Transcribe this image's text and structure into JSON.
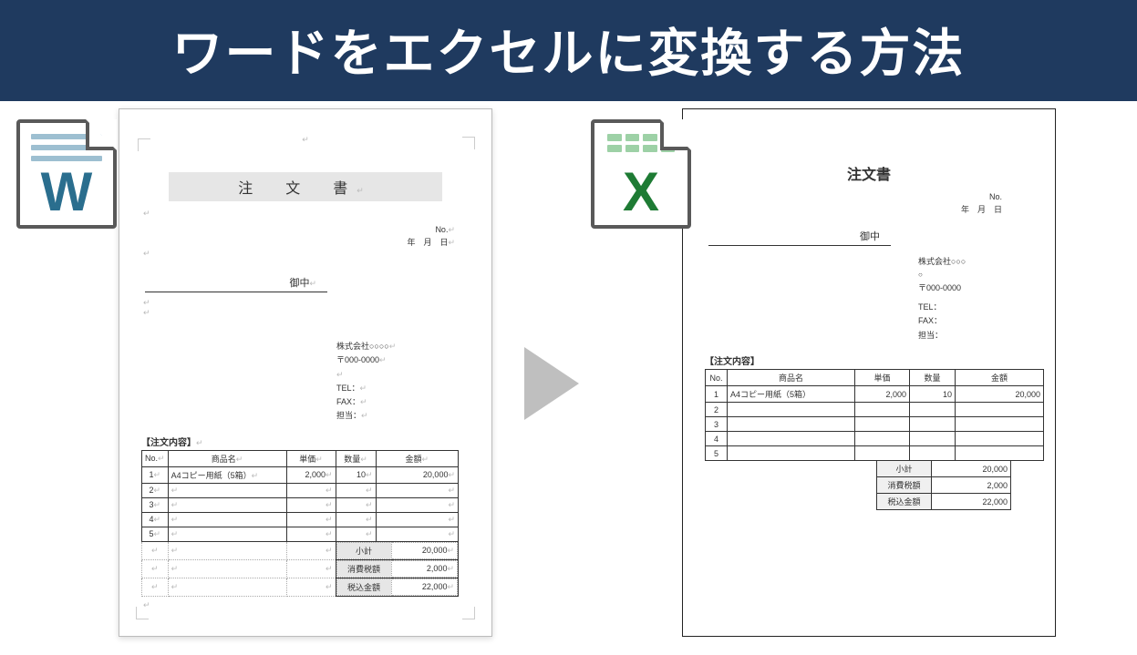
{
  "banner": "ワードをエクセルに変換する方法",
  "icons": {
    "word": "W",
    "excel": "X"
  },
  "word_doc": {
    "title": "注　文　書",
    "no_label": "No.",
    "date_suffix": "年　月　日",
    "onchuu": "御中",
    "company": "株式会社○○○○",
    "postal": "〒000-0000",
    "tel": "TEL：",
    "fax": "FAX：",
    "tantou": "担当：",
    "section": "【注文内容】",
    "headers": {
      "no": "No.",
      "name": "商品名",
      "unit": "単価",
      "qty": "数量",
      "amt": "金額"
    },
    "rows": [
      {
        "no": "1",
        "name": "A4コピー用紙（5箱）",
        "unit": "2,000",
        "qty": "10",
        "amt": "20,000"
      },
      {
        "no": "2",
        "name": "",
        "unit": "",
        "qty": "",
        "amt": ""
      },
      {
        "no": "3",
        "name": "",
        "unit": "",
        "qty": "",
        "amt": ""
      },
      {
        "no": "4",
        "name": "",
        "unit": "",
        "qty": "",
        "amt": ""
      },
      {
        "no": "5",
        "name": "",
        "unit": "",
        "qty": "",
        "amt": ""
      }
    ],
    "totals": {
      "subtotal_l": "小計",
      "subtotal_v": "20,000",
      "tax_l": "消費税額",
      "tax_v": "2,000",
      "grand_l": "税込金額",
      "grand_v": "22,000"
    }
  },
  "excel_doc": {
    "title": "注文書",
    "no_label": "No.",
    "date_suffix": "年　月　日",
    "onchuu": "御中",
    "company": "株式会社○○○",
    "postal": "〒000-0000",
    "tel": "TEL：",
    "fax": "FAX：",
    "tantou": "担当：",
    "section": "【注文内容】",
    "headers": {
      "no": "No.",
      "name": "商品名",
      "unit": "単価",
      "qty": "数量",
      "amt": "金額"
    },
    "rows": [
      {
        "no": "1",
        "name": "A4コピー用紙（5箱）",
        "unit": "2,000",
        "qty": "10",
        "amt": "20,000"
      },
      {
        "no": "2",
        "name": "",
        "unit": "",
        "qty": "",
        "amt": ""
      },
      {
        "no": "3",
        "name": "",
        "unit": "",
        "qty": "",
        "amt": ""
      },
      {
        "no": "4",
        "name": "",
        "unit": "",
        "qty": "",
        "amt": ""
      },
      {
        "no": "5",
        "name": "",
        "unit": "",
        "qty": "",
        "amt": ""
      }
    ],
    "totals": {
      "subtotal_l": "小計",
      "subtotal_v": "20,000",
      "tax_l": "消費税額",
      "tax_v": "2,000",
      "grand_l": "税込金額",
      "grand_v": "22,000"
    }
  }
}
